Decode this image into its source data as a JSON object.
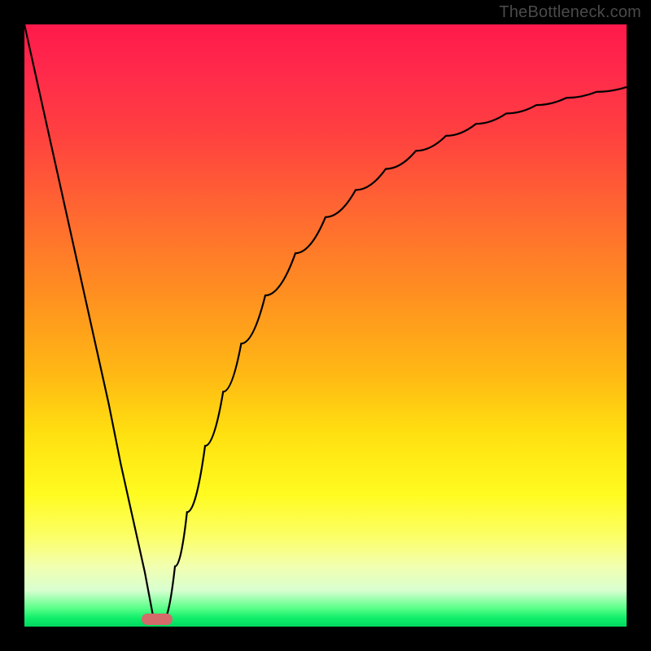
{
  "attribution": "TheBottleneck.com",
  "colors": {
    "frame": "#000000",
    "gradient_top": "#ff1a4b",
    "gradient_bottom": "#00d860",
    "curve": "#000000",
    "marker": "#d46a6a",
    "attribution_text": "#4a4a4a"
  },
  "chart_data": {
    "type": "line",
    "title": "",
    "xlabel": "",
    "ylabel": "",
    "xlim": [
      0,
      100
    ],
    "ylim": [
      0,
      100
    ],
    "annotations": [
      {
        "name": "optimal-marker",
        "x": 22,
        "y": 1.2,
        "shape": "pill"
      }
    ],
    "series": [
      {
        "name": "left-branch",
        "x": [
          0,
          2,
          4,
          6,
          8,
          10,
          12,
          14,
          16,
          18,
          20,
          21.5
        ],
        "values": [
          100,
          91,
          82,
          73,
          64,
          55,
          46,
          37,
          27,
          18,
          9,
          1
        ]
      },
      {
        "name": "right-branch",
        "x": [
          23,
          25,
          27,
          30,
          33,
          36,
          40,
          45,
          50,
          55,
          60,
          65,
          70,
          75,
          80,
          85,
          90,
          95,
          100
        ],
        "values": [
          1,
          10,
          19,
          30,
          39,
          47,
          55,
          62,
          68,
          72.5,
          76,
          79,
          81.5,
          83.5,
          85.2,
          86.6,
          87.8,
          88.8,
          89.6
        ]
      }
    ]
  }
}
